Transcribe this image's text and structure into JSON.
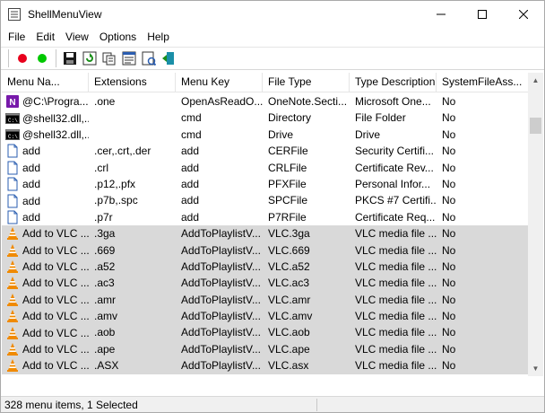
{
  "window": {
    "title": "ShellMenuView",
    "icon": "app-icon"
  },
  "menubar": {
    "items": [
      {
        "label": "File"
      },
      {
        "label": "Edit"
      },
      {
        "label": "View"
      },
      {
        "label": "Options"
      },
      {
        "label": "Help"
      }
    ]
  },
  "toolbar": {
    "buttons": [
      "disable-icon",
      "enable-icon",
      "save-icon",
      "refresh-icon",
      "copy-icon",
      "properties-icon",
      "html-report-icon",
      "exit-icon"
    ]
  },
  "list": {
    "columns": [
      "Menu Na...",
      "Extensions",
      "Menu Key",
      "File Type",
      "Type Description",
      "SystemFileAss..."
    ],
    "rows": [
      {
        "icon": "onenote-icon",
        "cells": [
          "@C:\\Progra...",
          ".one",
          "OpenAsReadO...",
          "OneNote.Secti...",
          "Microsoft One...",
          "No"
        ],
        "selected": false
      },
      {
        "icon": "cmd-icon",
        "cells": [
          "@shell32.dll,...",
          "",
          "cmd",
          "Directory",
          "File Folder",
          "No"
        ],
        "selected": false
      },
      {
        "icon": "cmd-icon",
        "cells": [
          "@shell32.dll,...",
          "",
          "cmd",
          "Drive",
          "Drive",
          "No"
        ],
        "selected": false
      },
      {
        "icon": "file-icon",
        "cells": [
          "add",
          ".cer,.crt,.der",
          "add",
          "CERFile",
          "Security Certifi...",
          "No"
        ],
        "selected": false
      },
      {
        "icon": "file-icon",
        "cells": [
          "add",
          ".crl",
          "add",
          "CRLFile",
          "Certificate Rev...",
          "No"
        ],
        "selected": false
      },
      {
        "icon": "file-icon",
        "cells": [
          "add",
          ".p12,.pfx",
          "add",
          "PFXFile",
          "Personal Infor...",
          "No"
        ],
        "selected": false
      },
      {
        "icon": "file-icon",
        "cells": [
          "add",
          ".p7b,.spc",
          "add",
          "SPCFile",
          "PKCS #7 Certifi...",
          "No"
        ],
        "selected": false
      },
      {
        "icon": "file-icon",
        "cells": [
          "add",
          ".p7r",
          "add",
          "P7RFile",
          "Certificate Req...",
          "No"
        ],
        "selected": false
      },
      {
        "icon": "vlc-icon",
        "cells": [
          "Add to VLC ...",
          ".3ga",
          "AddToPlaylistV...",
          "VLC.3ga",
          "VLC media file ...",
          "No"
        ],
        "selected": true
      },
      {
        "icon": "vlc-icon",
        "cells": [
          "Add to VLC ...",
          ".669",
          "AddToPlaylistV...",
          "VLC.669",
          "VLC media file ...",
          "No"
        ],
        "selected": true
      },
      {
        "icon": "vlc-icon",
        "cells": [
          "Add to VLC ...",
          ".a52",
          "AddToPlaylistV...",
          "VLC.a52",
          "VLC media file ...",
          "No"
        ],
        "selected": true
      },
      {
        "icon": "vlc-icon",
        "cells": [
          "Add to VLC ...",
          ".ac3",
          "AddToPlaylistV...",
          "VLC.ac3",
          "VLC media file ...",
          "No"
        ],
        "selected": true
      },
      {
        "icon": "vlc-icon",
        "cells": [
          "Add to VLC ...",
          ".amr",
          "AddToPlaylistV...",
          "VLC.amr",
          "VLC media file ...",
          "No"
        ],
        "selected": true
      },
      {
        "icon": "vlc-icon",
        "cells": [
          "Add to VLC ...",
          ".amv",
          "AddToPlaylistV...",
          "VLC.amv",
          "VLC media file ...",
          "No"
        ],
        "selected": true
      },
      {
        "icon": "vlc-icon",
        "cells": [
          "Add to VLC ...",
          ".aob",
          "AddToPlaylistV...",
          "VLC.aob",
          "VLC media file ...",
          "No"
        ],
        "selected": true
      },
      {
        "icon": "vlc-icon",
        "cells": [
          "Add to VLC ...",
          ".ape",
          "AddToPlaylistV...",
          "VLC.ape",
          "VLC media file ...",
          "No"
        ],
        "selected": true
      },
      {
        "icon": "vlc-icon",
        "cells": [
          "Add to VLC ...",
          ".ASX",
          "AddToPlaylistV...",
          "VLC.asx",
          "VLC media file ...",
          "No"
        ],
        "selected": true
      }
    ]
  },
  "status": {
    "text": "328 menu items, 1 Selected"
  },
  "colors": {
    "selected_row_bg": "#d9d9d9",
    "disable_red": "#e8001c",
    "enable_green": "#00c800",
    "vlc_orange": "#f08a00"
  }
}
